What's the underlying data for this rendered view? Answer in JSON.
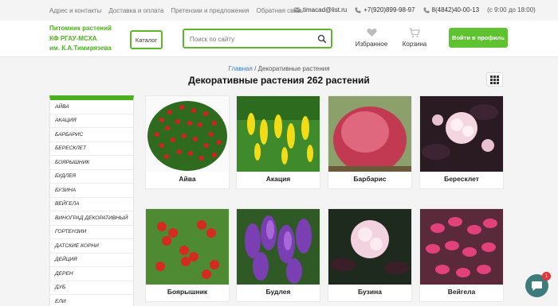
{
  "topbar": {
    "nav": [
      "Адрес и контакты",
      "Доставка и оплата",
      "Претензии и предложения",
      "Обратная связь"
    ],
    "email": "timacad@list.ru",
    "phone1": "+7(920)899-98-97",
    "phone2": "8(4842)40-00-13",
    "hours": "(с 9:00 до 18:00)"
  },
  "header": {
    "logo_lines": [
      "Питомник растений",
      "КФ РГАУ-МСХА",
      "им. К.А.Тимирязева"
    ],
    "catalog_label": "Каталог",
    "search_placeholder": "Поиск по сайту",
    "favorites_label": "Избранное",
    "cart_label": "Корзина",
    "login_label": "Войти в профиль"
  },
  "breadcrumb": {
    "home": "Главная",
    "separator": " / ",
    "current": "Декоративные растения"
  },
  "page_title": "Декоративные растения 262 растений",
  "sidebar": {
    "items": [
      "АЙВА",
      "АКАЦИЯ",
      "БАРБАРИС",
      "БЕРЕСКЛЕТ",
      "БОЯРЫШНИК",
      "БУДЛЕЯ",
      "БУЗИНА",
      "ВЕЙГЕЛА",
      "ВИНОГРАД ДЕКОРАТИВНЫЙ",
      "ГОРТЕНЗИИ",
      "ДАТСКИЕ КОРНИ",
      "ДЕЙЦИЯ",
      "ДЕРЕН",
      "ДУБ",
      "ЕЛИ"
    ]
  },
  "products": [
    {
      "name": "Айва"
    },
    {
      "name": "Акация"
    },
    {
      "name": "Барбарис"
    },
    {
      "name": "Бересклет"
    },
    {
      "name": "Боярышник"
    },
    {
      "name": "Будлея"
    },
    {
      "name": "Бузина"
    },
    {
      "name": "Вейгела"
    }
  ],
  "chat": {
    "badge": "1"
  },
  "colors": {
    "accent": "#5cb82a",
    "link": "#3c7fd6",
    "chat": "#3e7c7b",
    "badge": "#e8333a"
  }
}
